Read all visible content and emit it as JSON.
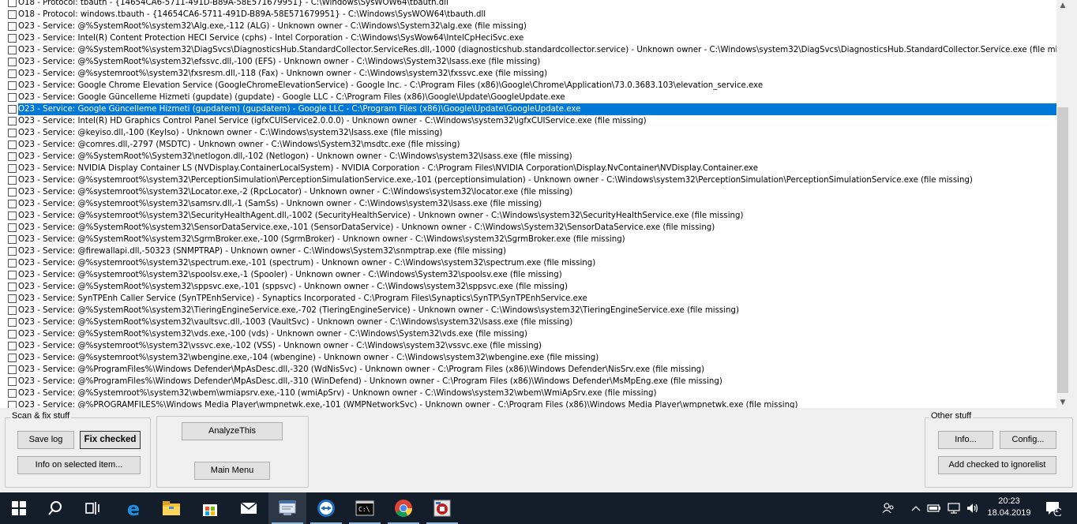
{
  "list": {
    "rows": [
      "O18 - Protocol: tbauth - {14654CA6-5711-491D-B89A-58E571679951} - C:\\Windows\\SysWOW64\\tbauth.dll",
      "O18 - Protocol: windows.tbauth - {14654CA6-5711-491D-B89A-58E571679951} - C:\\Windows\\SysWOW64\\tbauth.dll",
      "O23 - Service: @%SystemRoot%\\system32\\Alg.exe,-112 (ALG) - Unknown owner - C:\\Windows\\System32\\alg.exe (file missing)",
      "O23 - Service: Intel(R) Content Protection HECI Service (cphs) - Intel Corporation - C:\\Windows\\SysWow64\\IntelCpHeciSvc.exe",
      "O23 - Service: @%SystemRoot%\\system32\\DiagSvcs\\DiagnosticsHub.StandardCollector.ServiceRes.dll,-1000 (diagnosticshub.standardcollector.service) - Unknown owner - C:\\Windows\\system32\\DiagSvcs\\DiagnosticsHub.StandardCollector.Service.exe (file missing)",
      "O23 - Service: @%SystemRoot%\\system32\\efssvc.dll,-100 (EFS) - Unknown owner - C:\\Windows\\System32\\lsass.exe (file missing)",
      "O23 - Service: @%systemroot%\\system32\\fxsresm.dll,-118 (Fax) - Unknown owner - C:\\Windows\\system32\\fxssvc.exe (file missing)",
      "O23 - Service: Google Chrome Elevation Service (GoogleChromeElevationService) - Google Inc. - C:\\Program Files (x86)\\Google\\Chrome\\Application\\73.0.3683.103\\elevation_service.exe",
      "O23 - Service: Google Güncelleme Hizmeti (gupdate) (gupdate) - Google LLC - C:\\Program Files (x86)\\Google\\Update\\GoogleUpdate.exe",
      "O23 - Service: Google Güncelleme Hizmeti (gupdatem) (gupdatem) - Google LLC - C:\\Program Files (x86)\\Google\\Update\\GoogleUpdate.exe",
      "O23 - Service: Intel(R) HD Graphics Control Panel Service (igfxCUIService2.0.0.0) - Unknown owner - C:\\Windows\\system32\\igfxCUIService.exe (file missing)",
      "O23 - Service: @keyiso.dll,-100 (KeyIso) - Unknown owner - C:\\Windows\\system32\\lsass.exe (file missing)",
      "O23 - Service: @comres.dll,-2797 (MSDTC) - Unknown owner - C:\\Windows\\System32\\msdtc.exe (file missing)",
      "O23 - Service: @%SystemRoot%\\System32\\netlogon.dll,-102 (Netlogon) - Unknown owner - C:\\Windows\\system32\\lsass.exe (file missing)",
      "O23 - Service: NVIDIA Display Container LS (NVDisplay.ContainerLocalSystem) - NVIDIA Corporation - C:\\Program Files\\NVIDIA Corporation\\Display.NvContainer\\NVDisplay.Container.exe",
      "O23 - Service: @%systemroot%\\system32\\PerceptionSimulation\\PerceptionSimulationService.exe,-101 (perceptionsimulation) - Unknown owner - C:\\Windows\\system32\\PerceptionSimulation\\PerceptionSimulationService.exe (file missing)",
      "O23 - Service: @%systemroot%\\system32\\Locator.exe,-2 (RpcLocator) - Unknown owner - C:\\Windows\\system32\\locator.exe (file missing)",
      "O23 - Service: @%systemroot%\\system32\\samsrv.dll,-1 (SamSs) - Unknown owner - C:\\Windows\\system32\\lsass.exe (file missing)",
      "O23 - Service: @%systemroot%\\system32\\SecurityHealthAgent.dll,-1002 (SecurityHealthService) - Unknown owner - C:\\Windows\\system32\\SecurityHealthService.exe (file missing)",
      "O23 - Service: @%SystemRoot%\\system32\\SensorDataService.exe,-101 (SensorDataService) - Unknown owner - C:\\Windows\\System32\\SensorDataService.exe (file missing)",
      "O23 - Service: @%SystemRoot%\\system32\\SgrmBroker.exe,-100 (SgrmBroker) - Unknown owner - C:\\Windows\\system32\\SgrmBroker.exe (file missing)",
      "O23 - Service: @firewallapi.dll,-50323 (SNMPTRAP) - Unknown owner - C:\\Windows\\System32\\snmptrap.exe (file missing)",
      "O23 - Service: @%systemroot%\\system32\\spectrum.exe,-101 (spectrum) - Unknown owner - C:\\Windows\\system32\\spectrum.exe (file missing)",
      "O23 - Service: @%systemroot%\\system32\\spoolsv.exe,-1 (Spooler) - Unknown owner - C:\\Windows\\System32\\spoolsv.exe (file missing)",
      "O23 - Service: @%SystemRoot%\\system32\\sppsvc.exe,-101 (sppsvc) - Unknown owner - C:\\Windows\\system32\\sppsvc.exe (file missing)",
      "O23 - Service: SynTPEnh Caller Service (SynTPEnhService) - Synaptics Incorporated - C:\\Program Files\\Synaptics\\SynTP\\SynTPEnhService.exe",
      "O23 - Service: @%SystemRoot%\\system32\\TieringEngineService.exe,-702 (TieringEngineService) - Unknown owner - C:\\Windows\\system32\\TieringEngineService.exe (file missing)",
      "O23 - Service: @%SystemRoot%\\system32\\vaultsvc.dll,-1003 (VaultSvc) - Unknown owner - C:\\Windows\\system32\\lsass.exe (file missing)",
      "O23 - Service: @%SystemRoot%\\system32\\vds.exe,-100 (vds) - Unknown owner - C:\\Windows\\System32\\vds.exe (file missing)",
      "O23 - Service: @%systemroot%\\system32\\vssvc.exe,-102 (VSS) - Unknown owner - C:\\Windows\\system32\\vssvc.exe (file missing)",
      "O23 - Service: @%systemroot%\\system32\\wbengine.exe,-104 (wbengine) - Unknown owner - C:\\Windows\\system32\\wbengine.exe (file missing)",
      "O23 - Service: @%ProgramFiles%\\Windows Defender\\MpAsDesc.dll,-320 (WdNisSvc) - Unknown owner - C:\\Program Files (x86)\\Windows Defender\\NisSrv.exe (file missing)",
      "O23 - Service: @%ProgramFiles%\\Windows Defender\\MpAsDesc.dll,-310 (WinDefend) - Unknown owner - C:\\Program Files (x86)\\Windows Defender\\MsMpEng.exe (file missing)",
      "O23 - Service: @%Systemroot%\\system32\\wbem\\wmiapsrv.exe,-110 (wmiApSrv) - Unknown owner - C:\\Windows\\system32\\wbem\\WmiApSrv.exe (file missing)",
      "O23 - Service: @%PROGRAMFILES%\\Windows Media Player\\wmpnetwk.exe,-101 (WMPNetworkSvc) - Unknown owner - C:\\Program Files (x86)\\Windows Media Player\\wmpnetwk.exe (file missing)"
    ],
    "selected_index": 9,
    "selection_color": "#0078d7"
  },
  "scan_fix": {
    "legend": "Scan & fix stuff",
    "save_log": "Save log",
    "fix_checked": "Fix checked",
    "info_selected": "Info on selected item..."
  },
  "middle": {
    "analyze": "AnalyzeThis",
    "main_menu": "Main Menu"
  },
  "other": {
    "legend": "Other stuff",
    "info": "Info...",
    "config": "Config...",
    "add_ignore": "Add checked to ignorelist"
  },
  "taskbar": {
    "icons": [
      "windows-start-icon",
      "search-icon",
      "task-view-icon",
      "edge-icon",
      "file-explorer-icon",
      "store-icon",
      "mail-icon",
      "app-window-icon",
      "teamviewer-icon",
      "terminal-icon",
      "chrome-icon",
      "hijackthis-icon"
    ],
    "clock_time": "20:23",
    "clock_date": "18.04.2019",
    "notification_count": "1",
    "bg_color": "#141e2a"
  }
}
